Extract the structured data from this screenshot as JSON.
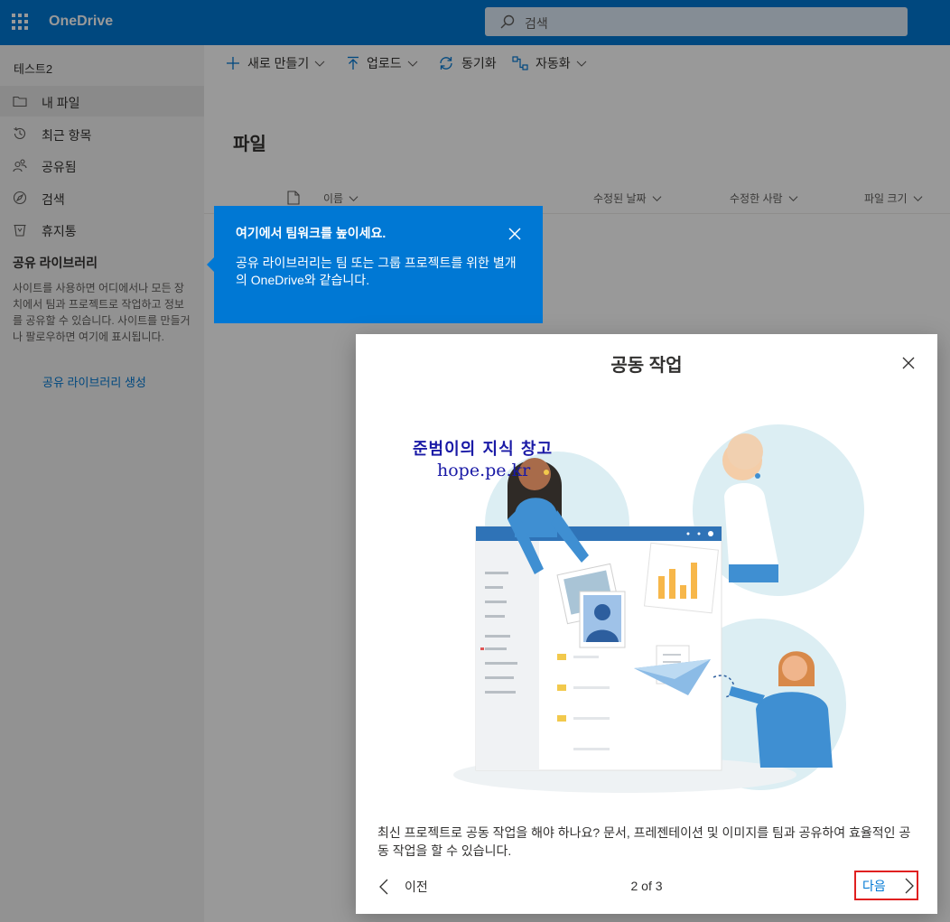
{
  "header": {
    "app_name": "OneDrive",
    "search_placeholder": "검색"
  },
  "leftnav": {
    "username": "테스트2",
    "items": [
      {
        "label": "내 파일",
        "icon": "folder-icon",
        "active": true
      },
      {
        "label": "최근 항목",
        "icon": "history-icon",
        "active": false
      },
      {
        "label": "공유됨",
        "icon": "people-icon",
        "active": false
      },
      {
        "label": "검색",
        "icon": "discover-icon",
        "active": false
      },
      {
        "label": "휴지통",
        "icon": "trash-icon",
        "active": false
      }
    ],
    "shared_libraries_title": "공유 라이브러리",
    "shared_libraries_desc": "사이트를 사용하면 어디에서나 모든 장치에서 팀과 프로젝트로 작업하고 정보를 공유할 수 있습니다. 사이트를 만들거나 팔로우하면 여기에 표시됩니다.",
    "create_link": "공유 라이브러리 생성"
  },
  "commandbar": {
    "new_label": "새로 만들기",
    "upload_label": "업로드",
    "sync_label": "동기화",
    "automate_label": "자동화"
  },
  "main": {
    "title": "파일",
    "columns": [
      "이름",
      "수정된 날짜",
      "수정한 사람",
      "파일 크기"
    ]
  },
  "teaching_bubble": {
    "title": "여기에서 팀워크를 높이세요.",
    "body": "공유 라이브러리는 팀 또는 그룹 프로젝트를 위한 별개의 OneDrive와 같습니다."
  },
  "dialog": {
    "title": "공동 작업",
    "watermark_line1": "준범이의 지식 창고",
    "watermark_line2": "hope.pe.kr",
    "description": "최신 프로젝트로 공동 작업을 해야 하나요? 문서, 프레젠테이션 및 이미지를 팀과 공유하여 효율적인 공동 작업을 할 수 있습니다.",
    "prev_label": "이전",
    "pager": "2 of 3",
    "next_label": "다음"
  },
  "colors": {
    "brand": "#0078d4",
    "highlight_border": "#e02020"
  }
}
